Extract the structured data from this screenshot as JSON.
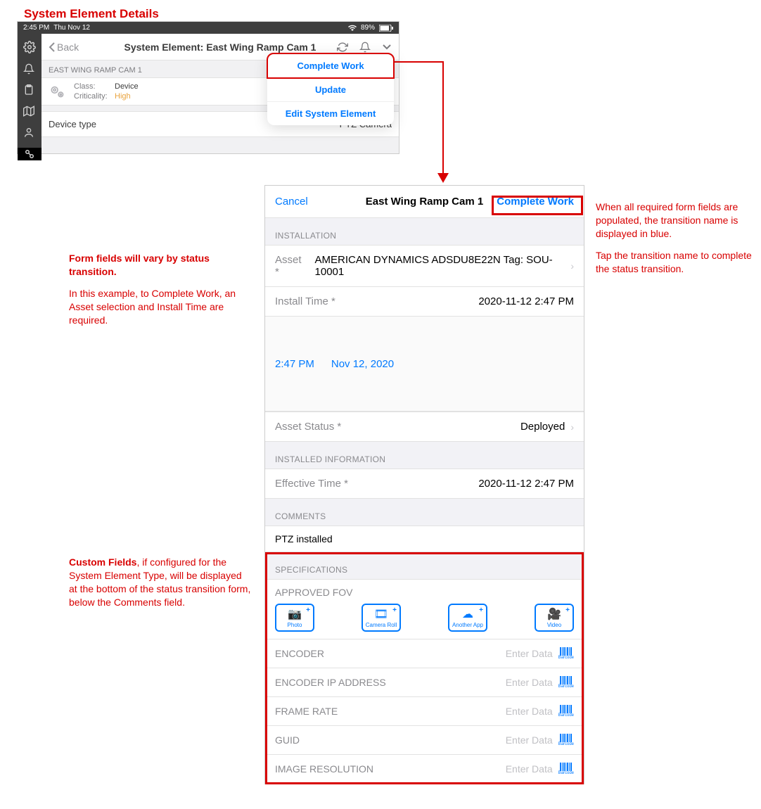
{
  "page_title": "System Element Details",
  "screenshot1": {
    "status_bar": {
      "time": "2:45 PM",
      "date": "Thu Nov 12",
      "battery": "89%"
    },
    "back": "Back",
    "title": "System Element: East Wing Ramp Cam 1",
    "section_header": "EAST WING RAMP CAM 1",
    "class_label": "Class:",
    "class_value": "Device",
    "criticality_label": "Criticality:",
    "criticality_value": "High",
    "device_type_label": "Device type",
    "device_type_value": "PTZ Camera"
  },
  "popover": {
    "items": [
      "Complete Work",
      "Update",
      "Edit System Element"
    ]
  },
  "annotations": {
    "left1_bold": "Form fields will vary by status transition.",
    "left1_body": "In this example, to Complete Work, an Asset selection and Install Time are required.",
    "right1_p1": "When all required form fields are  populated, the transition name is displayed in blue.",
    "right1_p2": "Tap the transition name to complete the status transition.",
    "left2_bold": "Custom Fields",
    "left2_body": ", if configured for the System Element Type, will be displayed at the bottom of the status transition form, below the Comments field."
  },
  "modal": {
    "cancel": "Cancel",
    "title": "East Wing Ramp Cam 1",
    "action": "Complete Work",
    "sections": {
      "installation": "INSTALLATION",
      "asset_label": "Asset *",
      "asset_value": "AMERICAN DYNAMICS ADSDU8E22N Tag: SOU-10001",
      "install_time_label": "Install Time *",
      "install_time_value": "2020-11-12 2:47 PM",
      "picker_time": "2:47 PM",
      "picker_date": "Nov 12, 2020",
      "asset_status_label": "Asset Status *",
      "asset_status_value": "Deployed",
      "installed_info": "INSTALLED INFORMATION",
      "effective_time_label": "Effective Time *",
      "effective_time_value": "2020-11-12 2:47 PM",
      "comments_hdr": "COMMENTS",
      "comments_body": "PTZ installed",
      "specifications_hdr": "SPECIFICATIONS",
      "approved_fov": "APPROVED FOV",
      "media": {
        "photo": "Photo",
        "camera_roll": "Camera Roll",
        "another_app": "Another App",
        "video": "Video"
      },
      "spec_rows": [
        "ENCODER",
        "ENCODER IP ADDRESS",
        "FRAME RATE",
        "GUID",
        "IMAGE RESOLUTION"
      ],
      "placeholder": "Enter Data",
      "barcode": "Barcode"
    }
  }
}
